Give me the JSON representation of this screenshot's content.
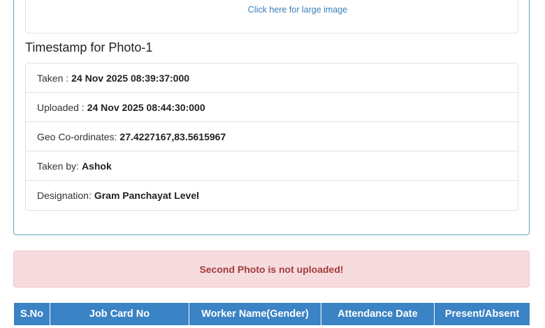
{
  "photo_card": {
    "large_image_link": "Click here for large image"
  },
  "timestamp_section": {
    "title": "Timestamp for Photo-1",
    "rows": [
      {
        "label": "Taken :",
        "value": "24 Nov 2025 08:39:37:000"
      },
      {
        "label": "Uploaded :",
        "value": "24 Nov 2025 08:44:30:000"
      },
      {
        "label": "Geo Co-ordinates:",
        "value": "27.4227167,83.5615967"
      },
      {
        "label": "Taken by:",
        "value": "Ashok"
      },
      {
        "label": "Designation:",
        "value": "Gram Panchayat Level"
      }
    ]
  },
  "alert": {
    "message": "Second Photo is not uploaded!"
  },
  "attendance_table": {
    "columns": [
      "S.No",
      "Job Card No",
      "Worker Name(Gender)",
      "Attendance Date",
      "Present/Absent"
    ]
  },
  "colors": {
    "table_header": "#3a83c4",
    "alert_background": "#f6dcde",
    "alert_text": "#a23a3c",
    "link": "#3a7fb8",
    "panel_border": "#5fa8b8"
  }
}
